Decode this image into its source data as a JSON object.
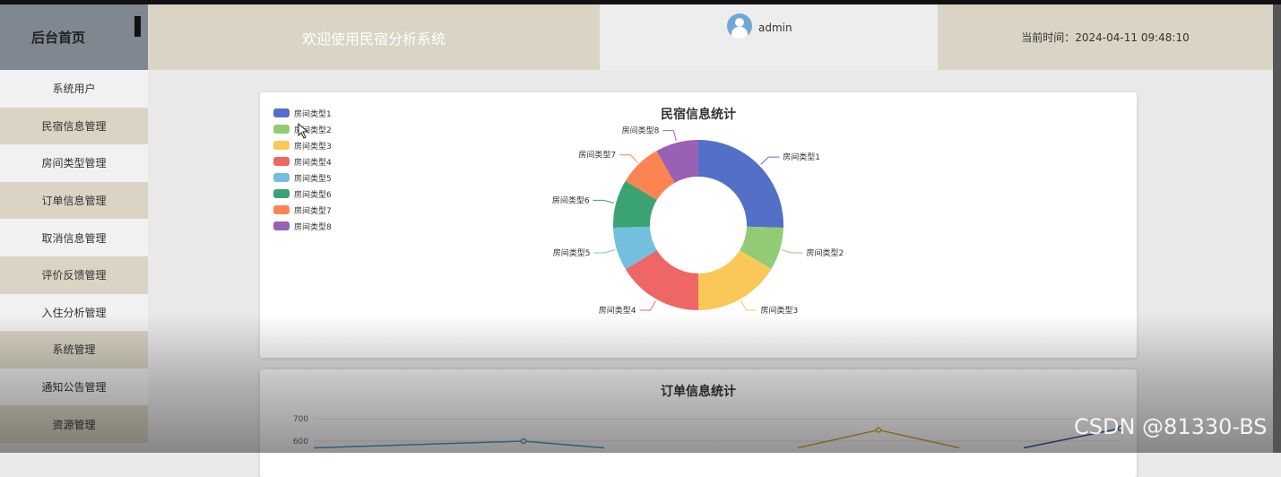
{
  "header": {
    "brand": "后台首页",
    "welcome": "欢迎使用民宿分析系统",
    "username": "admin",
    "time": "当前时间：2024-04-11 09:48:10"
  },
  "sidebar": {
    "items": [
      {
        "label": "系统用户"
      },
      {
        "label": "民宿信息管理"
      },
      {
        "label": "房间类型管理"
      },
      {
        "label": "订单信息管理"
      },
      {
        "label": "取消信息管理"
      },
      {
        "label": "评价反馈管理"
      },
      {
        "label": "入住分析管理"
      },
      {
        "label": "系统管理"
      },
      {
        "label": "通知公告管理"
      },
      {
        "label": "资源管理"
      }
    ]
  },
  "pie_card": {
    "title": "民宿信息统计",
    "legend": [
      "房间类型1",
      "房间类型2",
      "房间类型3",
      "房间类型4",
      "房间类型5",
      "房间类型6",
      "房间类型7",
      "房间类型8"
    ]
  },
  "line_card": {
    "title": "订单信息统计"
  },
  "watermark": "CSDN @81330-BS",
  "chart_data": [
    {
      "type": "pie",
      "title": "民宿信息统计",
      "donut": true,
      "legend_position": "top-left",
      "categories": [
        "房间类型1",
        "房间类型2",
        "房间类型3",
        "房间类型4",
        "房间类型5",
        "房间类型6",
        "房间类型7",
        "房间类型8"
      ],
      "values": [
        25,
        8,
        16,
        16,
        8,
        9,
        8,
        8
      ],
      "colors": [
        "#5470c6",
        "#91cc75",
        "#fac858",
        "#ee6666",
        "#73c0de",
        "#3ba272",
        "#fc8452",
        "#9a60b4"
      ]
    },
    {
      "type": "line",
      "title": "订单信息统计",
      "y_ticks": [
        600,
        700
      ],
      "ylim": [
        570,
        720
      ],
      "series": [
        {
          "color": "#4b9fc8",
          "points": [
            [
              0,
              570
            ],
            [
              0.26,
              600
            ],
            [
              0.36,
              570
            ]
          ]
        },
        {
          "color": "#d6a635",
          "points": [
            [
              0.6,
              570
            ],
            [
              0.7,
              650
            ],
            [
              0.8,
              570
            ]
          ]
        },
        {
          "color": "#3d5fa3",
          "points": [
            [
              0.88,
              570
            ],
            [
              1.0,
              657
            ]
          ]
        }
      ]
    }
  ]
}
